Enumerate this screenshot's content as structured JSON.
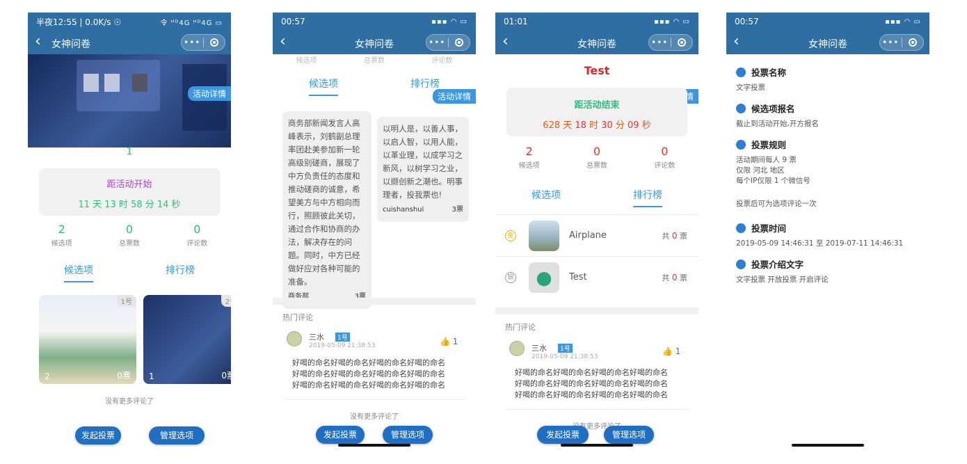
{
  "app_title": "女神问卷",
  "activity_tag": "活动详情",
  "s1": {
    "status_time": "半夜12:55 | 0.0K/s ☉",
    "status_icons": "令 ᴴᴰ4G ᴴᴰ4G ▭",
    "index": "1",
    "countdown_label": "距活动开始",
    "countdown": {
      "days": "11",
      "hours": "13",
      "minutes": "58",
      "seconds": "14",
      "u_day": " 天 ",
      "u_hour": " 时 ",
      "u_min": " 分 ",
      "u_sec": " 秒"
    },
    "stats": [
      {
        "num": "2",
        "cap": "候选项"
      },
      {
        "num": "0",
        "cap": "总票数"
      },
      {
        "num": "0",
        "cap": "评论数"
      }
    ],
    "tabs": [
      "候选项",
      "排行榜"
    ],
    "thumbs": [
      {
        "rank": "1号",
        "idx": "2",
        "votes": "0票"
      },
      {
        "rank": "2号",
        "idx": "1",
        "votes": "0票"
      }
    ],
    "no_more": "没有更多评论了",
    "btn_start": "发起投票",
    "btn_manage": "管理选项"
  },
  "s2": {
    "status_time": "00:57",
    "tabs": [
      "候选项",
      "排行榜"
    ],
    "faded_stats": [
      "候选项",
      "总票数",
      "评论数"
    ],
    "card1": {
      "text": "商务部新闻发言人高峰表示，刘鹤副总理率团赴美参加新一轮高级别磋商，展现了中方负责任的态度和推动磋商的诚意，希望美方与中方相向而行，照顾彼此关切，通过合作和协商的办法，解决存在的问题。同时，中方已经做好应对各种可能的准备。",
      "author": "商务部",
      "votes": "3票"
    },
    "card2": {
      "text": "以明人是，以善人事，以启人智，以用人能，以革业理，以成学习之新风，以树学习之业，以撷创新之潮也。明事理者，投我票也!",
      "author": "cuishanshui",
      "votes": "3票"
    },
    "comments_head": "热门评论",
    "comment": {
      "name": "三水",
      "floor": "1号",
      "date": "2019-05-09 21:38:53",
      "likes": "1",
      "text": "好喝的命名好喝的命名好喝的命名好喝的命名好喝的命名好喝的命名好喝的命名好喝的命名好喝的命名好喝的命名好喝的命名好喝的命名"
    },
    "no_more": "没有更多评论了",
    "btn_start": "发起投票",
    "btn_manage": "管理选项"
  },
  "s3": {
    "status_time": "01:01",
    "title": "Test",
    "countdown_label": "距活动结束",
    "countdown": {
      "days": "628",
      "hours": "18",
      "minutes": "30",
      "seconds": "09",
      "u_day": " 天 ",
      "u_hour": " 时 ",
      "u_min": " 分 ",
      "u_sec": " 秒"
    },
    "stats": [
      {
        "num": "2",
        "cap": "候选项"
      },
      {
        "num": "0",
        "cap": "总票数"
      },
      {
        "num": "0",
        "cap": "评论数"
      }
    ],
    "tabs": [
      "候选项",
      "排行榜"
    ],
    "ranks": [
      {
        "medal": "金",
        "name": "Airplane",
        "votes_pre": "共 ",
        "votes": "0",
        "votes_suf": " 票"
      },
      {
        "medal": "银",
        "name": "Test",
        "votes_pre": "共 ",
        "votes": "0",
        "votes_suf": " 票"
      }
    ],
    "comments_head": "热门评论",
    "comment": {
      "name": "三水",
      "floor": "1号",
      "date": "2019-05-09 21:38:53",
      "likes": "1",
      "text": "好喝的命名好喝的命名好喝的命名好喝的命名好喝的命名好喝的命名好喝的命名好喝的命名好喝的命名好喝的命名好喝的命名好喝的命名"
    },
    "no_more": "没有更多评论了",
    "btn_start": "发起投票",
    "btn_manage": "管理选项"
  },
  "s4": {
    "status_time": "00:57",
    "sections": [
      {
        "title": "投票名称",
        "desc": "文字投票"
      },
      {
        "title": "候选项报名",
        "desc": "截止到活动开始,开方报名"
      },
      {
        "title": "投票规则",
        "desc": "活动期间每人 9 票\n仅限 河北 地区\n每个IP仅限 1 个微信号"
      },
      {
        "title": "",
        "desc": "投票后可为选项评论一次"
      },
      {
        "title": "投票时间",
        "desc": "2019-05-09 14:46:31  至  2019-07-11 14:46:31"
      },
      {
        "title": "投票介绍文字",
        "desc": "文字投票 开放投票 开启评论"
      }
    ]
  },
  "colors": {
    "nav": "#2f6ea3",
    "accent": "#3b97e2",
    "green": "#2cc17b",
    "red": "#e33333",
    "purple": "#b13fd6"
  }
}
